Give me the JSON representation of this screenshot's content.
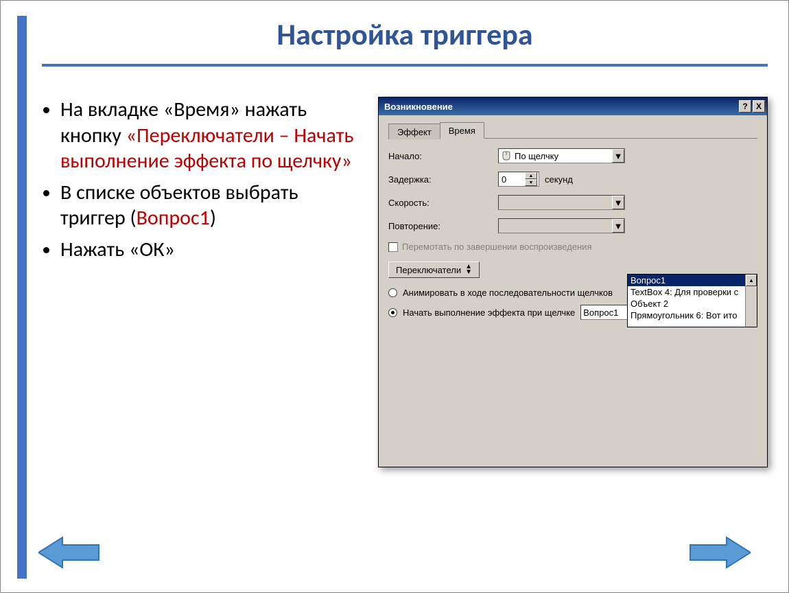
{
  "slide": {
    "title": "Настройка триггера",
    "bullets": {
      "b1a": "На вкладке «Время» нажать кнопку ",
      "b1b": "«Переключатели – Начать выполнение эффекта по щелчку»",
      "b2a": "В списке объектов выбрать триггер (",
      "b2b": "Вопрос1",
      "b2c": ")",
      "b3": "Нажать «ОК»"
    }
  },
  "dialog": {
    "title": "Возникновение",
    "help_btn": "?",
    "close_btn": "X",
    "tabs": {
      "effect": "Эффект",
      "time": "Время"
    },
    "labels": {
      "start": "Начало:",
      "delay": "Задержка:",
      "speed": "Скорость:",
      "repeat": "Повторение:",
      "rewind": "Перемотать по завершении воспроизведения",
      "switches": "Переключатели",
      "seconds": "секунд"
    },
    "values": {
      "start": "По щелчку",
      "delay": "0",
      "speed": "",
      "repeat": ""
    },
    "radios": {
      "r1": "Анимировать в ходе последовательности щелчков",
      "r2": "Начать выполнение эффекта при щелчке"
    },
    "trigger_selected": "Вопрос1",
    "object_list": [
      "Вопрос1",
      "TextBox 4: Для проверки с",
      "Объект 2",
      "Прямоугольник 6: Вот ито"
    ]
  }
}
